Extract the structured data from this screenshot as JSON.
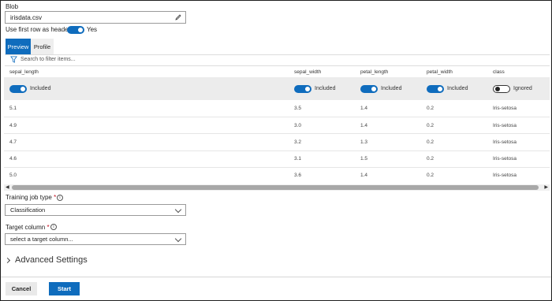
{
  "blob": {
    "label": "Blob",
    "value": "irisdata.csv",
    "edit_icon": "pencil-icon"
  },
  "header_option": {
    "label": "Use first row as header",
    "state": "Yes"
  },
  "tabs": [
    {
      "label": "Preview",
      "active": true
    },
    {
      "label": "Profile",
      "active": false
    }
  ],
  "filter": {
    "icon": "filter-icon",
    "placeholder": "Search to filter items..."
  },
  "table": {
    "columns": [
      {
        "name": "sepal_length",
        "toggle": "Included",
        "on": true
      },
      {
        "name": "sepal_width",
        "toggle": "Included",
        "on": true
      },
      {
        "name": "petal_length",
        "toggle": "Included",
        "on": true
      },
      {
        "name": "petal_width",
        "toggle": "Included",
        "on": true
      },
      {
        "name": "class",
        "toggle": "Ignored",
        "on": false
      }
    ],
    "rows": [
      [
        "5.1",
        "3.5",
        "1.4",
        "0.2",
        "Iris-setosa"
      ],
      [
        "4.9",
        "3.0",
        "1.4",
        "0.2",
        "Iris-setosa"
      ],
      [
        "4.7",
        "3.2",
        "1.3",
        "0.2",
        "Iris-setosa"
      ],
      [
        "4.6",
        "3.1",
        "1.5",
        "0.2",
        "Iris-setosa"
      ],
      [
        "5.0",
        "3.6",
        "1.4",
        "0.2",
        "Iris-setosa"
      ]
    ]
  },
  "training_job": {
    "label": "Training job type",
    "required": "*",
    "value": "Classification"
  },
  "target_column": {
    "label": "Target column",
    "required": "*",
    "placeholder": "select a target column..."
  },
  "advanced": {
    "label": "Advanced Settings"
  },
  "footer": {
    "cancel_label": "Cancel",
    "start_label": "Start"
  },
  "colors": {
    "accent": "#0f6cbd",
    "required": "#c50f1f"
  }
}
